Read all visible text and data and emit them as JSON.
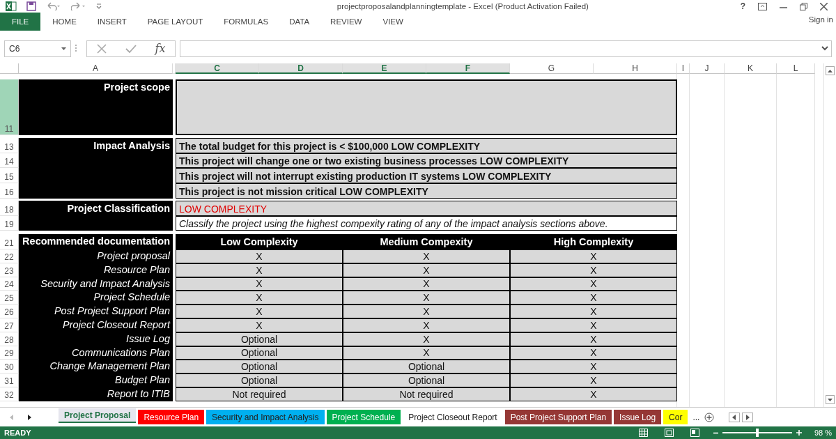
{
  "window": {
    "title": "projectproposalandplanningtemplate - Excel (Product Activation Failed)",
    "help": "?"
  },
  "ribbon": {
    "tabs": [
      {
        "label": "FILE",
        "selected": true
      },
      {
        "label": "HOME",
        "selected": false
      },
      {
        "label": "INSERT",
        "selected": false
      },
      {
        "label": "PAGE LAYOUT",
        "selected": false
      },
      {
        "label": "FORMULAS",
        "selected": false
      },
      {
        "label": "DATA",
        "selected": false
      },
      {
        "label": "REVIEW",
        "selected": false
      },
      {
        "label": "VIEW",
        "selected": false
      }
    ],
    "sign_in": "Sign in"
  },
  "formula_bar": {
    "name_box": "C6",
    "fx": "fx"
  },
  "columns": [
    {
      "label": "A",
      "selected": false
    },
    {
      "label": "C",
      "selected": true
    },
    {
      "label": "D",
      "selected": true
    },
    {
      "label": "E",
      "selected": true
    },
    {
      "label": "F",
      "selected": true
    },
    {
      "label": "G",
      "selected": false
    },
    {
      "label": "H",
      "selected": false
    },
    {
      "label": "I",
      "selected": false
    },
    {
      "label": "J",
      "selected": false
    },
    {
      "label": "K",
      "selected": false
    },
    {
      "label": "L",
      "selected": false
    }
  ],
  "row_numbers": [
    {
      "label": "11",
      "selected": true
    },
    {
      "label": "13",
      "selected": false
    },
    {
      "label": "14",
      "selected": false
    },
    {
      "label": "15",
      "selected": false
    },
    {
      "label": "16",
      "selected": false
    },
    {
      "label": "18",
      "selected": false
    },
    {
      "label": "19",
      "selected": false
    },
    {
      "label": "21",
      "selected": false
    },
    {
      "label": "22",
      "selected": false
    },
    {
      "label": "23",
      "selected": false
    },
    {
      "label": "24",
      "selected": false
    },
    {
      "label": "25",
      "selected": false
    },
    {
      "label": "26",
      "selected": false
    },
    {
      "label": "27",
      "selected": false
    },
    {
      "label": "28",
      "selected": false
    },
    {
      "label": "29",
      "selected": false
    },
    {
      "label": "30",
      "selected": false
    },
    {
      "label": "31",
      "selected": false
    },
    {
      "label": "32",
      "selected": false
    }
  ],
  "scope": {
    "label": "Project scope"
  },
  "impact": {
    "label": "Impact Analysis",
    "lines": [
      "The total budget for this project is < $100,000 LOW COMPLEXITY",
      "This project will change one or two existing business processes LOW COMPLEXITY",
      "This project will not interrupt existing production IT systems LOW COMPLEXITY",
      "This project is not mission critical LOW COMPLEXITY"
    ]
  },
  "classification": {
    "label": "Project Classification",
    "value": "LOW COMPLEXITY",
    "note": "Classify the project using the highest compexity rating of any of the impact analysis sections above."
  },
  "documentation": {
    "label": "Recommended documentation",
    "headers": [
      "Low Complexity",
      "Medium Compexity",
      "High Complexity"
    ],
    "rows": [
      {
        "name": "Project proposal",
        "cells": [
          "X",
          "X",
          "X"
        ]
      },
      {
        "name": "Resource Plan",
        "cells": [
          "X",
          "X",
          "X"
        ]
      },
      {
        "name": "Security and Impact Analysis",
        "cells": [
          "X",
          "X",
          "X"
        ]
      },
      {
        "name": "Project Schedule",
        "cells": [
          "X",
          "X",
          "X"
        ]
      },
      {
        "name": "Post Project Support Plan",
        "cells": [
          "X",
          "X",
          "X"
        ]
      },
      {
        "name": "Project Closeout Report",
        "cells": [
          "X",
          "X",
          "X"
        ]
      },
      {
        "name": "Issue Log",
        "cells": [
          "Optional",
          "X",
          "X"
        ]
      },
      {
        "name": "Communications Plan",
        "cells": [
          "Optional",
          "X",
          "X"
        ]
      },
      {
        "name": "Change Management Plan",
        "cells": [
          "Optional",
          "Optional",
          "X"
        ]
      },
      {
        "name": "Budget Plan",
        "cells": [
          "Optional",
          "Optional",
          "X"
        ]
      },
      {
        "name": "Report to ITIB",
        "cells": [
          "Not required",
          "Not required",
          "X"
        ]
      }
    ]
  },
  "sheet_tabs": [
    {
      "label": "Project Proposal",
      "selected": true
    },
    {
      "label": "Resource Plan",
      "selected": false,
      "color": "#ff0000"
    },
    {
      "label": "Security and Impact Analysis",
      "selected": false,
      "color": "#00b0f0"
    },
    {
      "label": "Project Schedule",
      "selected": false,
      "color": "#00b050"
    },
    {
      "label": "Project Closeout Report",
      "selected": false
    },
    {
      "label": "Post Project Support Plan",
      "selected": false,
      "color": "#953735"
    },
    {
      "label": "Issue Log",
      "selected": false,
      "color": "#953735"
    },
    {
      "label": "Cor",
      "selected": false,
      "color": "#ffff00"
    }
  ],
  "more_tabs": "...",
  "status": {
    "text": "READY",
    "zoom": "98 %",
    "level": 0.5
  }
}
